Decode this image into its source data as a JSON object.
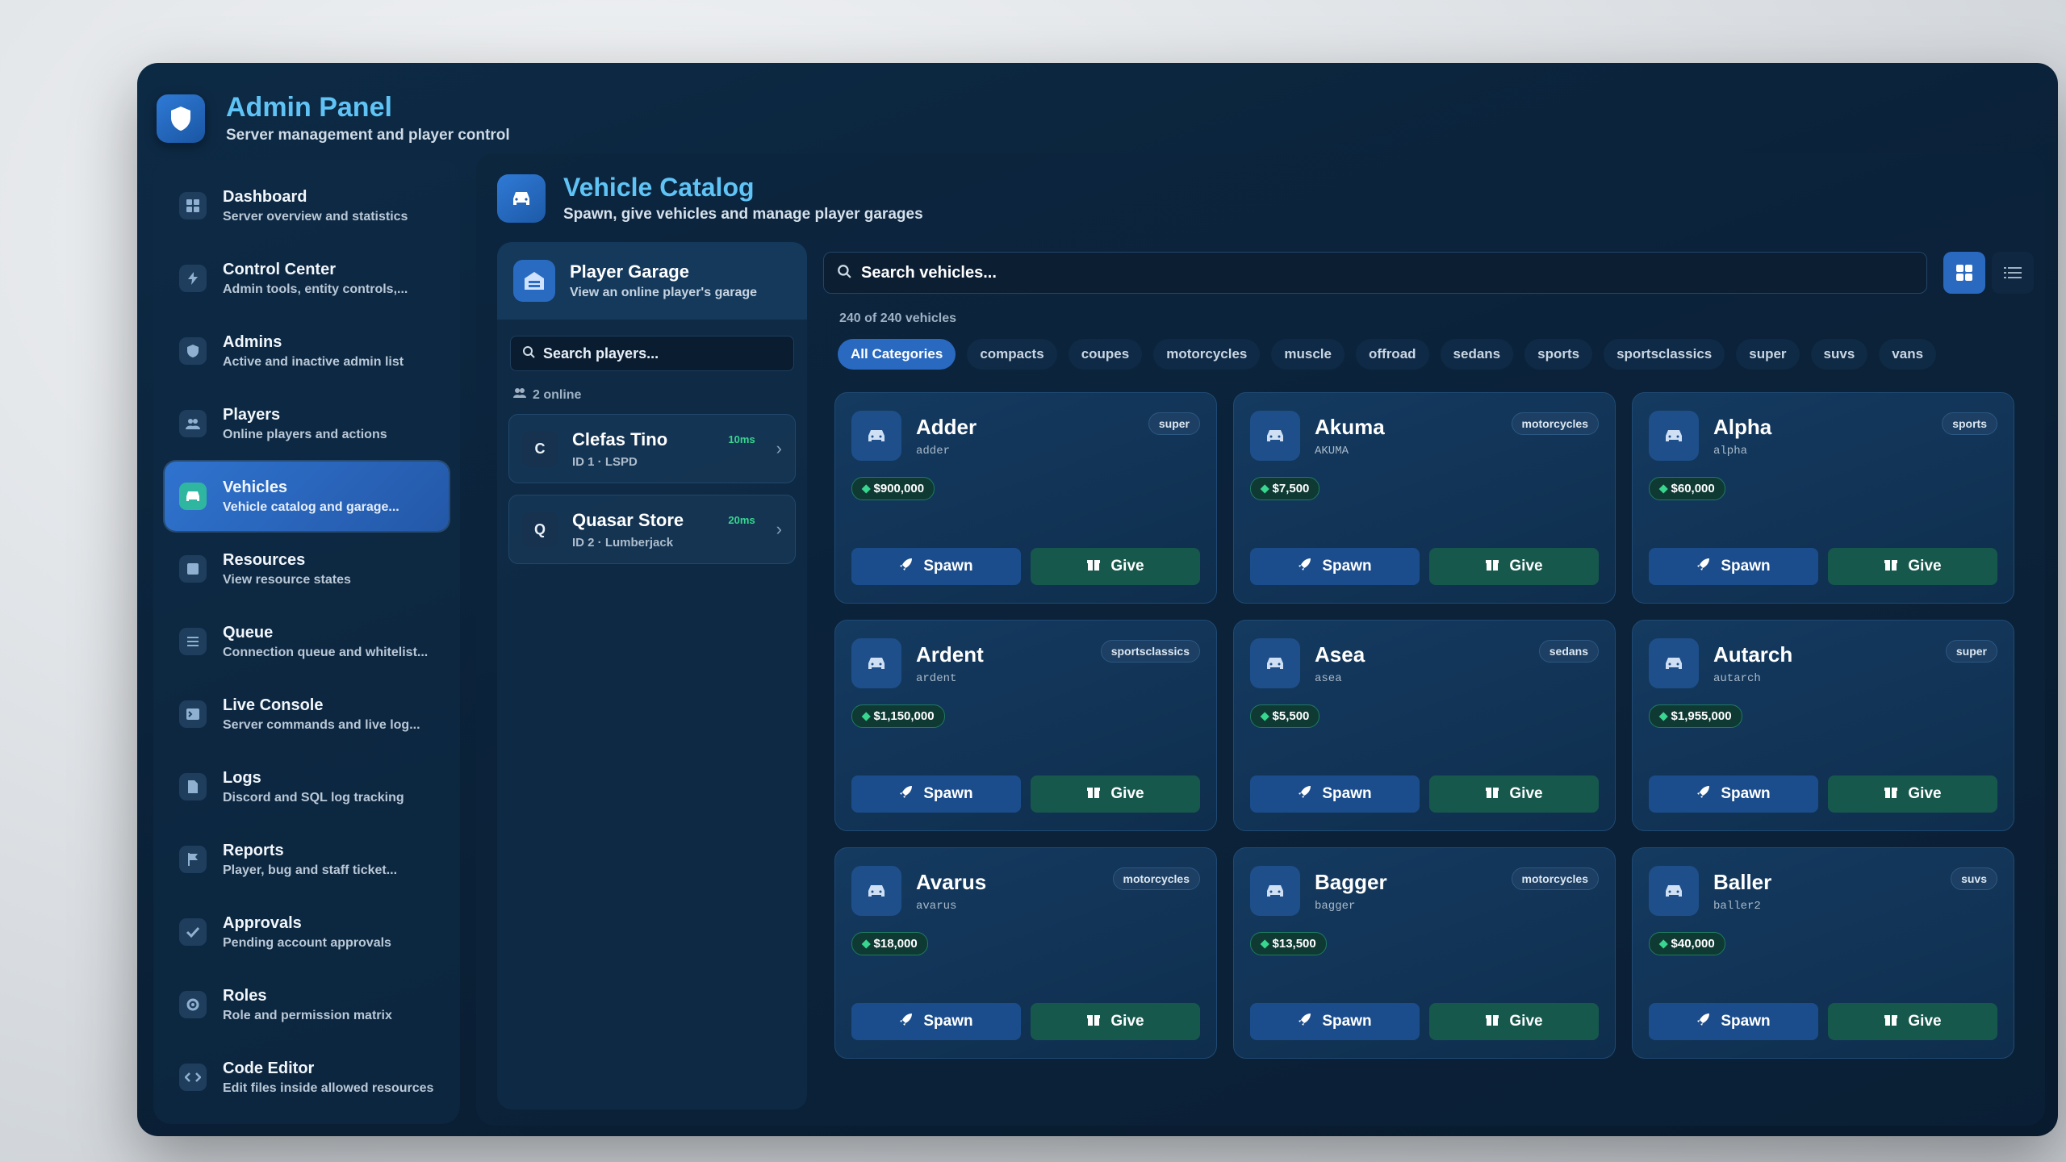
{
  "app": {
    "title": "Admin Panel",
    "subtitle": "Server management and player control"
  },
  "sidebar": {
    "items": [
      {
        "label": "Dashboard",
        "desc": "Server overview and statistics",
        "icon": "grid-icon"
      },
      {
        "label": "Control Center",
        "desc": "Admin tools, entity controls,...",
        "icon": "bolt-icon"
      },
      {
        "label": "Admins",
        "desc": "Active and inactive admin list",
        "icon": "shield-icon"
      },
      {
        "label": "Players",
        "desc": "Online players and actions",
        "icon": "users-icon"
      },
      {
        "label": "Vehicles",
        "desc": "Vehicle catalog and garage...",
        "icon": "car-icon",
        "active": true
      },
      {
        "label": "Resources",
        "desc": "View resource states",
        "icon": "box-icon"
      },
      {
        "label": "Queue",
        "desc": "Connection queue and whitelist...",
        "icon": "list-icon"
      },
      {
        "label": "Live Console",
        "desc": "Server commands and live log...",
        "icon": "terminal-icon"
      },
      {
        "label": "Logs",
        "desc": "Discord and SQL log tracking",
        "icon": "file-icon"
      },
      {
        "label": "Reports",
        "desc": "Player, bug and staff ticket...",
        "icon": "flag-icon"
      },
      {
        "label": "Approvals",
        "desc": "Pending account approvals",
        "icon": "check-icon"
      },
      {
        "label": "Roles",
        "desc": "Role and permission matrix",
        "icon": "gear-icon"
      },
      {
        "label": "Code Editor",
        "desc": "Edit files inside allowed resources",
        "icon": "code-icon"
      }
    ]
  },
  "main": {
    "title": "Vehicle Catalog",
    "subtitle": "Spawn, give vehicles and manage player garages"
  },
  "garage": {
    "title": "Player Garage",
    "subtitle": "View an online player's garage",
    "search_placeholder": "Search players...",
    "online_text": "2 online",
    "players": [
      {
        "initial": "C",
        "name": "Clefas Tino",
        "ping": "10ms",
        "id": "ID 1 · LSPD"
      },
      {
        "initial": "Q",
        "name": "Quasar Store",
        "ping": "20ms",
        "id": "ID 2 · Lumberjack"
      }
    ]
  },
  "catalog": {
    "search_placeholder": "Search vehicles...",
    "count_text": "240 of 240 vehicles",
    "categories": [
      "All Categories",
      "compacts",
      "coupes",
      "motorcycles",
      "muscle",
      "offroad",
      "sedans",
      "sports",
      "sportsclassics",
      "super",
      "suvs",
      "vans"
    ],
    "spawn_label": "Spawn",
    "give_label": "Give",
    "vehicles": [
      {
        "name": "Adder",
        "model": "adder",
        "category": "super",
        "price": "$900,000"
      },
      {
        "name": "Akuma",
        "model": "AKUMA",
        "category": "motorcycles",
        "price": "$7,500"
      },
      {
        "name": "Alpha",
        "model": "alpha",
        "category": "sports",
        "price": "$60,000"
      },
      {
        "name": "Ardent",
        "model": "ardent",
        "category": "sportsclassics",
        "price": "$1,150,000"
      },
      {
        "name": "Asea",
        "model": "asea",
        "category": "sedans",
        "price": "$5,500"
      },
      {
        "name": "Autarch",
        "model": "autarch",
        "category": "super",
        "price": "$1,955,000"
      },
      {
        "name": "Avarus",
        "model": "avarus",
        "category": "motorcycles",
        "price": "$18,000"
      },
      {
        "name": "Bagger",
        "model": "bagger",
        "category": "motorcycles",
        "price": "$13,500"
      },
      {
        "name": "Baller",
        "model": "baller2",
        "category": "suvs",
        "price": "$40,000"
      }
    ]
  },
  "colors": {
    "accent": "#5fc3f5",
    "primary": "#2a69c0",
    "success": "#38d68e",
    "background": "#0a2036"
  }
}
